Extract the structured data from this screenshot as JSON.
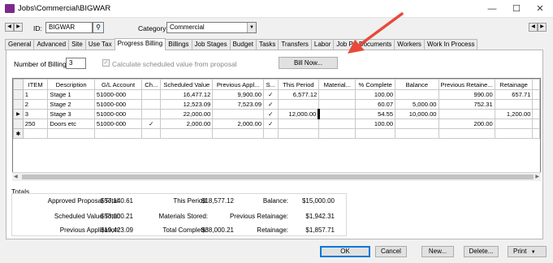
{
  "window": {
    "title": "Jobs\\Commercial\\BIGWAR"
  },
  "header": {
    "id_label": "ID:",
    "id_value": "BIGWAR",
    "category_label": "Category:",
    "category_value": "Commercial"
  },
  "tabs": [
    "General",
    "Advanced",
    "Site",
    "Use Tax",
    "Progress Billing",
    "Billings",
    "Job Stages",
    "Budget",
    "Tasks",
    "Transfers",
    "Labor",
    "Job P",
    "Documents",
    "Workers",
    "Work In Process"
  ],
  "active_tab": "Progress Billing",
  "billing": {
    "num_billings_label": "Number of Billings:",
    "num_billings_value": "3",
    "calc_label": "Calculate scheduled value from proposal",
    "bill_now": "Bill Now..."
  },
  "grid": {
    "columns": [
      "ITEM",
      "Description",
      "G/L Account",
      "Ch...",
      "Scheduled Value",
      "Previous Appl...",
      "S...",
      "This Period",
      "Material...",
      "% Complete",
      "Balance",
      "Previous Retaine...",
      "Retainage"
    ],
    "rows": [
      {
        "marker": "",
        "item": "1",
        "description": "Stage 1",
        "gl": "51000-000",
        "ch": "",
        "scheduled": "16,477.12",
        "prev_app": "9,900.00",
        "s": "✓",
        "this_period": "6,577.12",
        "material": "",
        "pct": "100.00",
        "balance": "",
        "prev_ret": "990.00",
        "retainage": "657.71"
      },
      {
        "marker": "",
        "item": "2",
        "description": "Stage 2",
        "gl": "51000-000",
        "ch": "",
        "scheduled": "12,523.09",
        "prev_app": "7,523.09",
        "s": "✓",
        "this_period": "",
        "material": "",
        "pct": "60.07",
        "balance": "5,000.00",
        "prev_ret": "752.31",
        "retainage": ""
      },
      {
        "marker": "▶",
        "item": "3",
        "description": "Stage 3",
        "gl": "51000-000",
        "ch": "",
        "scheduled": "22,000.00",
        "prev_app": "",
        "s": "✓",
        "this_period": "12,000.00",
        "material": "",
        "pct": "54.55",
        "balance": "10,000.00",
        "prev_ret": "",
        "retainage": "1,200.00"
      },
      {
        "marker": "",
        "item": "250",
        "description": "Doors etc",
        "gl": "51000-000",
        "ch": "✓",
        "scheduled": "2,000.00",
        "prev_app": "2,000.00",
        "s": "✓",
        "this_period": "",
        "material": "",
        "pct": "100.00",
        "balance": "",
        "prev_ret": "200.00",
        "retainage": ""
      }
    ],
    "new_row_marker": "✱"
  },
  "totals": {
    "title": "Totals",
    "approved_label": "Approved Proposal Total:",
    "approved_value": "$57,140.61",
    "sched_label": "Scheduled Value Total:",
    "sched_value": "$53,000.21",
    "prevapp_label": "Previous Application:",
    "prevapp_value": "$19,423.09",
    "thisperiod_label": "This Period:",
    "thisperiod_value": "$18,577.12",
    "materials_label": "Materials Stored:",
    "materials_value": "",
    "totalcomplete_label": "Total Complete:",
    "totalcomplete_value": "$38,000.21",
    "balance_label": "Balance:",
    "balance_value": "$15,000.00",
    "prevret_label": "Previous Retainage:",
    "prevret_value": "$1,942.31",
    "retainage_label": "Retainage:",
    "retainage_value": "$1,857.71"
  },
  "footer": {
    "ok": "OK",
    "cancel": "Cancel",
    "new": "New...",
    "delete": "Delete...",
    "print": "Print"
  },
  "colors": {
    "accent": "#e8493a",
    "app_icon": "#7b2a8c",
    "focus": "#0078d7"
  }
}
